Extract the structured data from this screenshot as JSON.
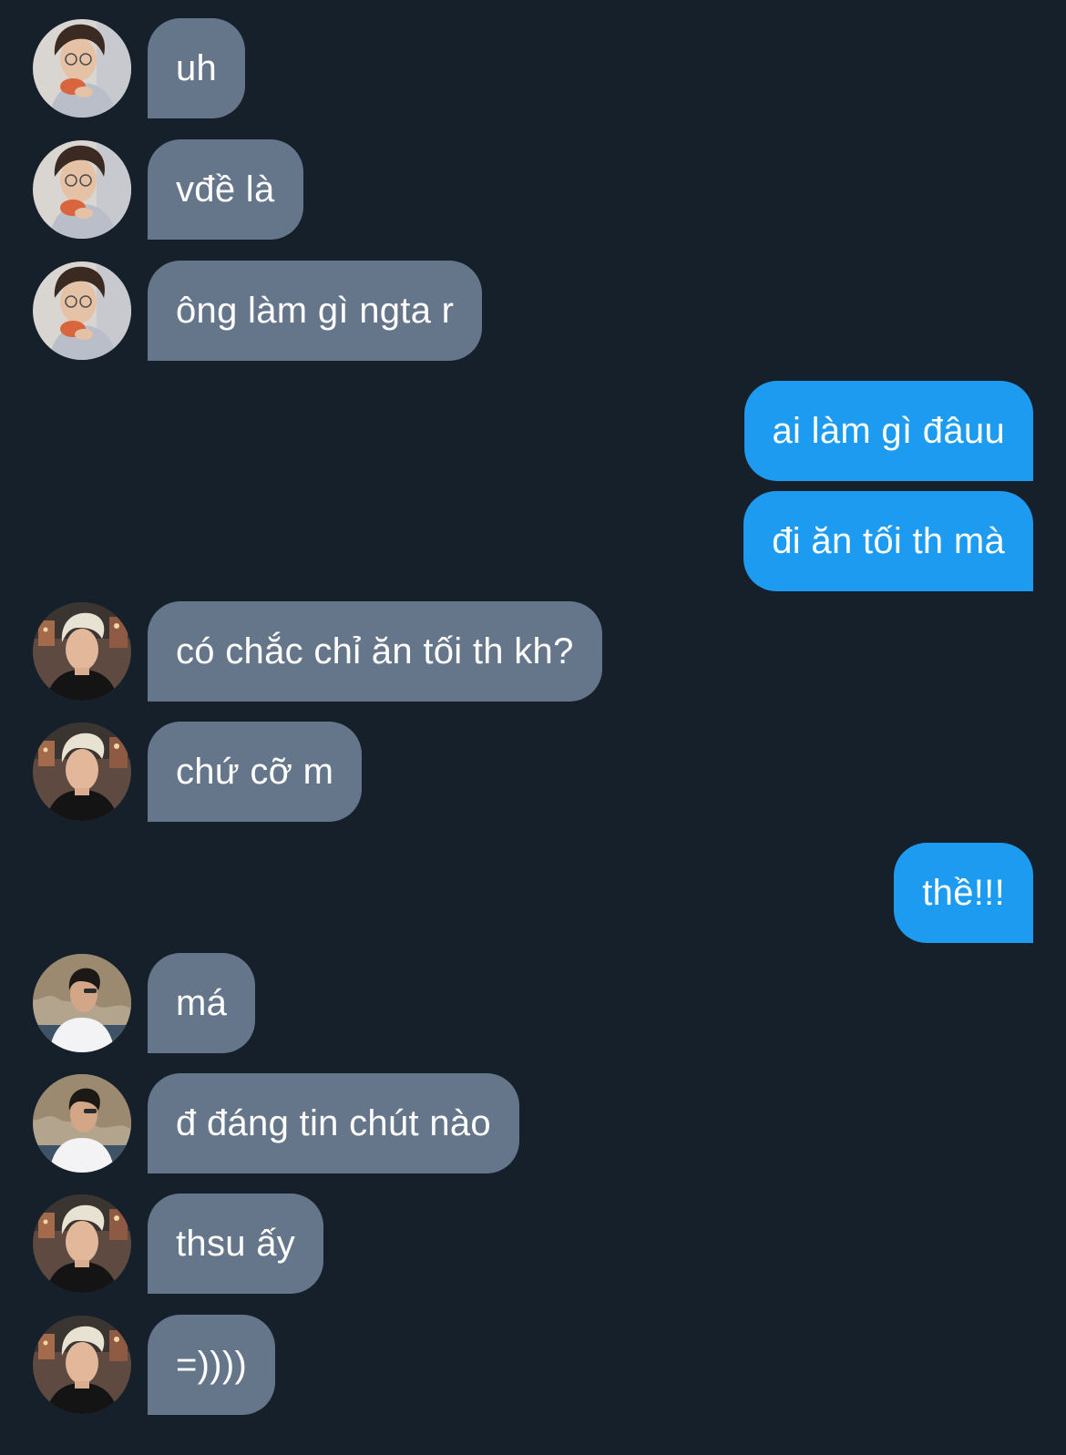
{
  "conversation": {
    "messages": [
      {
        "direction": "in",
        "avatar": "curly-hair-glasses-avatar",
        "text": "uh"
      },
      {
        "direction": "in",
        "avatar": "curly-hair-glasses-avatar",
        "text": "vđề là"
      },
      {
        "direction": "in",
        "avatar": "curly-hair-glasses-avatar",
        "text": "ông làm gì ngta r"
      },
      {
        "direction": "out",
        "text": "ai làm gì đâuu"
      },
      {
        "direction": "out",
        "text": "đi ăn tối th mà"
      },
      {
        "direction": "in",
        "avatar": "blonde-hair-avatar",
        "text": "có chắc chỉ ăn tối th kh?"
      },
      {
        "direction": "in",
        "avatar": "blonde-hair-avatar",
        "text": "chứ cỡ m"
      },
      {
        "direction": "out",
        "text": "thề!!!"
      },
      {
        "direction": "in",
        "avatar": "white-shirt-cliff-avatar",
        "text": "má"
      },
      {
        "direction": "in",
        "avatar": "white-shirt-cliff-avatar",
        "text": "đ đáng tin chút nào"
      },
      {
        "direction": "in",
        "avatar": "blonde-hair-avatar",
        "text": "thsu ấy"
      },
      {
        "direction": "in",
        "avatar": "blonde-hair-avatar",
        "text": "=))))"
      }
    ]
  },
  "colors": {
    "background": "#15202b",
    "incoming_bubble": "#66768a",
    "outgoing_bubble": "#1d9bf0",
    "text": "#ffffff"
  }
}
